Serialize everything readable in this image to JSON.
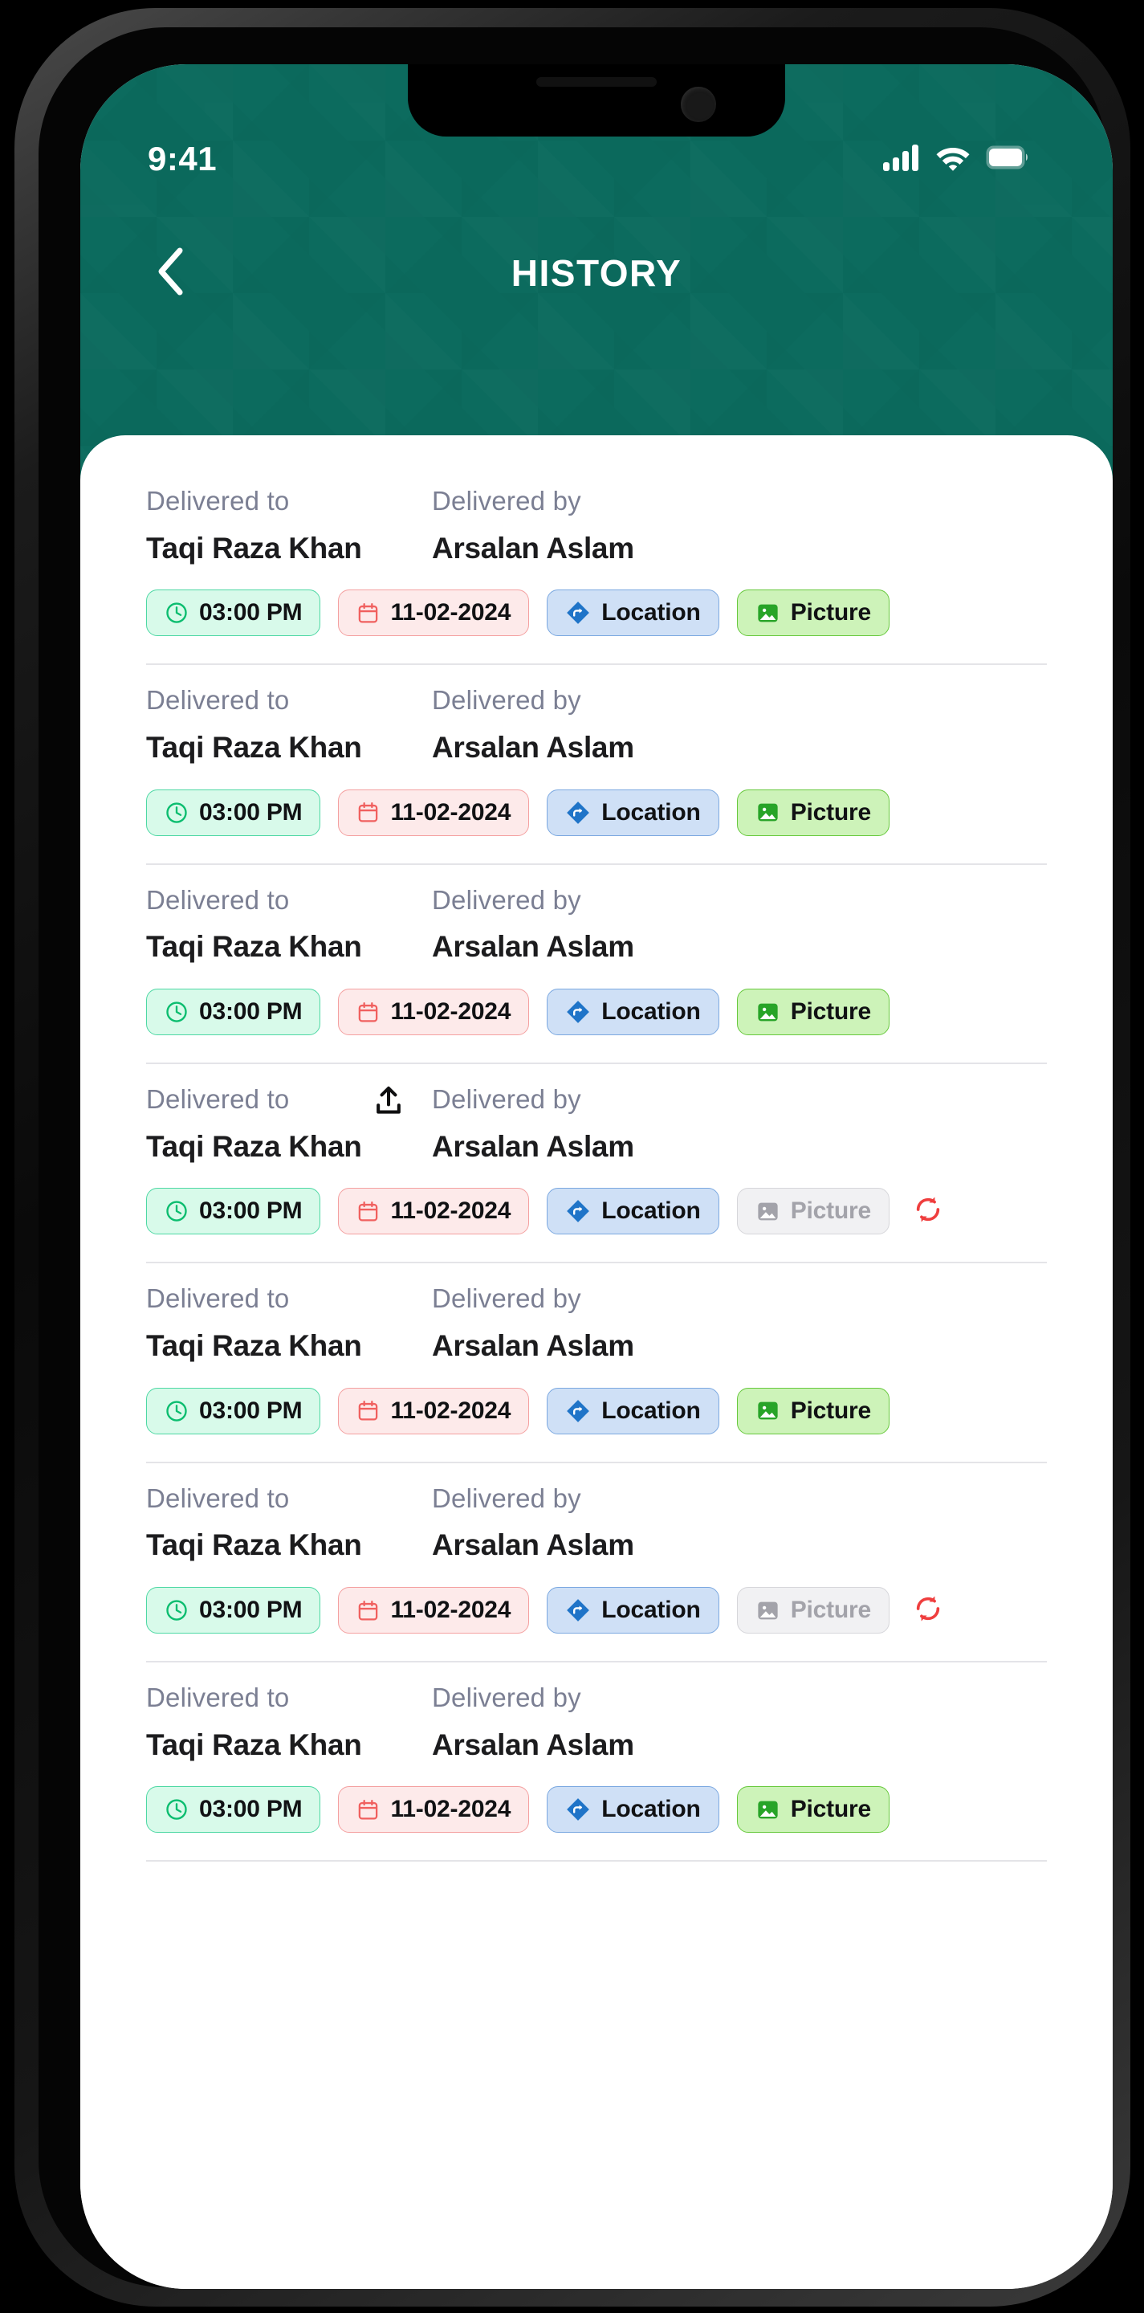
{
  "status_bar": {
    "time": "9:41",
    "icons": [
      "signal-bars-icon",
      "wifi-icon",
      "battery-icon"
    ]
  },
  "header": {
    "title": "HISTORY",
    "back_icon": "chevron-left-icon",
    "background_color": "#0c6b5e"
  },
  "labels": {
    "delivered_to": "Delivered to",
    "delivered_by": "Delivered by"
  },
  "chip_labels": {
    "location": "Location",
    "picture": "Picture"
  },
  "colors": {
    "brand_teal": "#0c6b5e",
    "time_chip_bg": "#d8faea",
    "time_chip_border": "#4ed8a4",
    "time_chip_icon": "#0bbd6f",
    "date_chip_bg": "#fdeaea",
    "date_chip_border": "#f4a0a0",
    "date_chip_icon": "#f0605f",
    "location_chip_bg": "#cfe0f6",
    "location_chip_border": "#7ba8e0",
    "location_chip_icon": "#1f74c8",
    "picture_chip_bg": "#cdf3b9",
    "picture_chip_border": "#68c93e",
    "picture_chip_icon": "#28a428",
    "picture_disabled_bg": "#f1f1f3",
    "picture_disabled_text": "#a3a3aa",
    "retry_icon": "#ef3e3e",
    "label_text": "#7b7f93",
    "value_text": "#1c1c1e",
    "divider": "#e4e4e8"
  },
  "rows": [
    {
      "delivered_to": "Taqi Raza Khan",
      "delivered_by": "Arsalan Aslam",
      "time": "03:00 PM",
      "date": "11-02-2024",
      "picture_enabled": true,
      "has_retry": false,
      "has_upload": false
    },
    {
      "delivered_to": "Taqi Raza Khan",
      "delivered_by": "Arsalan Aslam",
      "time": "03:00 PM",
      "date": "11-02-2024",
      "picture_enabled": true,
      "has_retry": false,
      "has_upload": false
    },
    {
      "delivered_to": "Taqi Raza Khan",
      "delivered_by": "Arsalan Aslam",
      "time": "03:00 PM",
      "date": "11-02-2024",
      "picture_enabled": true,
      "has_retry": false,
      "has_upload": false
    },
    {
      "delivered_to": "Taqi Raza Khan",
      "delivered_by": "Arsalan Aslam",
      "time": "03:00 PM",
      "date": "11-02-2024",
      "picture_enabled": false,
      "has_retry": true,
      "has_upload": true
    },
    {
      "delivered_to": "Taqi Raza Khan",
      "delivered_by": "Arsalan Aslam",
      "time": "03:00 PM",
      "date": "11-02-2024",
      "picture_enabled": true,
      "has_retry": false,
      "has_upload": false
    },
    {
      "delivered_to": "Taqi Raza Khan",
      "delivered_by": "Arsalan Aslam",
      "time": "03:00 PM",
      "date": "11-02-2024",
      "picture_enabled": false,
      "has_retry": true,
      "has_upload": false
    },
    {
      "delivered_to": "Taqi Raza Khan",
      "delivered_by": "Arsalan Aslam",
      "time": "03:00 PM",
      "date": "11-02-2024",
      "picture_enabled": true,
      "has_retry": false,
      "has_upload": false
    }
  ]
}
